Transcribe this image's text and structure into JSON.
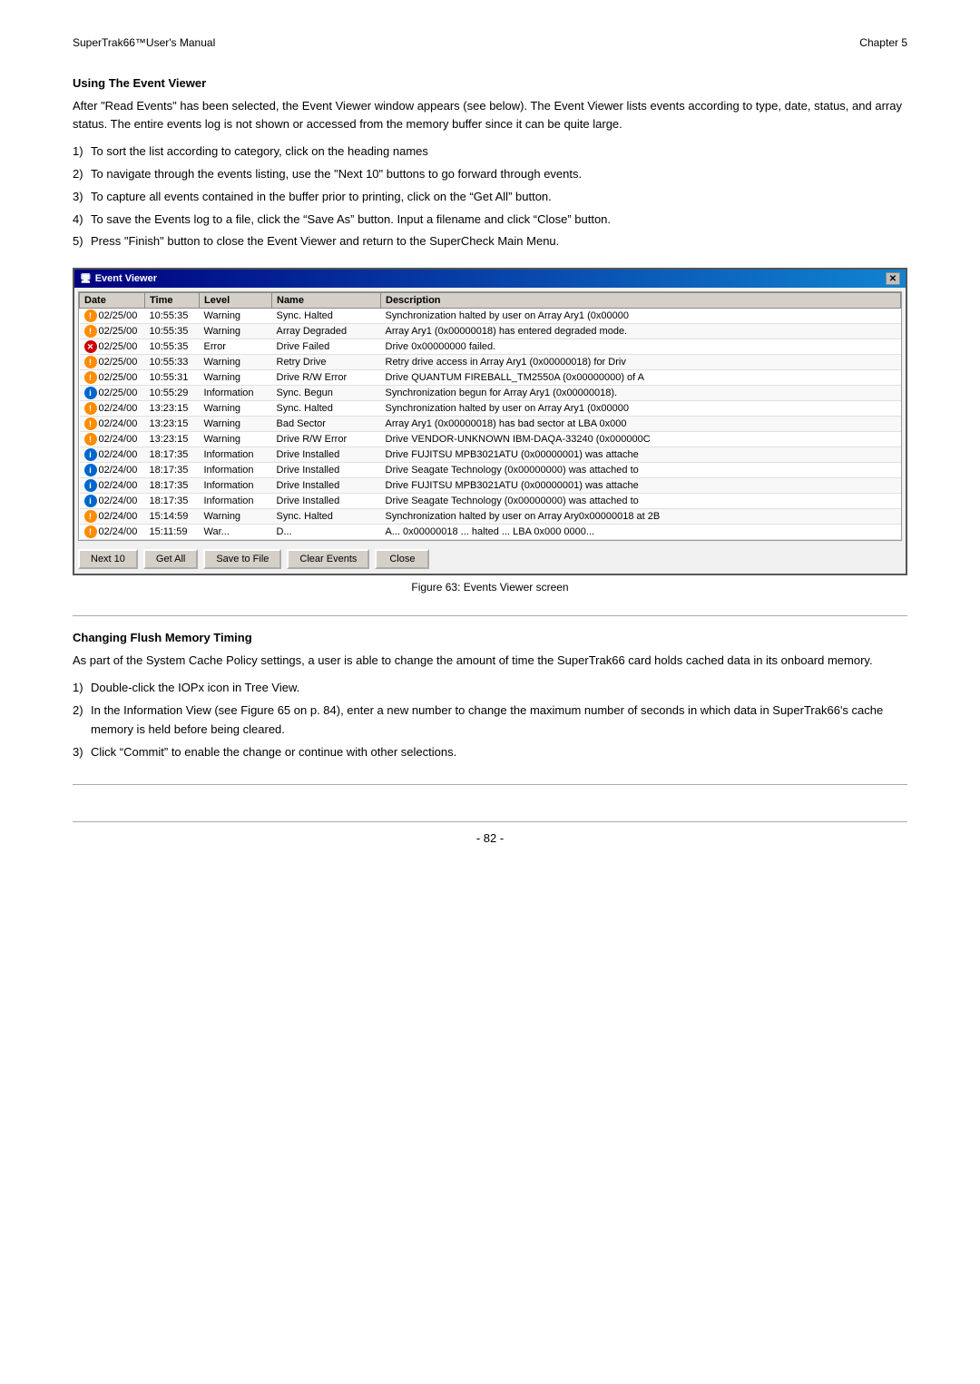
{
  "header": {
    "left": "SuperTrak66™User's Manual",
    "right": "Chapter 5"
  },
  "section1": {
    "title": "Using The Event Viewer",
    "body": "After \"Read Events\" has been selected, the Event Viewer window appears (see below). The Event Viewer lists events according to type, date, status, and array status. The entire events log is not shown or accessed from the memory buffer since it can be quite large.",
    "list": [
      {
        "num": "1)",
        "text": "To sort the list according to category, click on the heading names"
      },
      {
        "num": "2)",
        "text": "To navigate through the events listing, use the \"Next 10\" buttons to go forward through events."
      },
      {
        "num": "3)",
        "text": "To capture all events contained in the buffer prior to printing, click on the “Get All” button."
      },
      {
        "num": "4)",
        "text": "To save the Events log to a file, click the “Save As” button. Input a filename and click “Close” button."
      },
      {
        "num": "5)",
        "text": "Press \"Finish\" button to close the Event Viewer and return to the SuperCheck Main Menu."
      }
    ]
  },
  "event_viewer": {
    "title": "Event Viewer",
    "columns": [
      "Date",
      "Time",
      "Level",
      "Name",
      "Description"
    ],
    "rows": [
      {
        "icon": "warning",
        "date": "02/25/00",
        "time": "10:55:35",
        "level": "Warning",
        "name": "Sync. Halted",
        "desc": "Synchronization halted by user on Array Ary1     (0x00000"
      },
      {
        "icon": "warning",
        "date": "02/25/00",
        "time": "10:55:35",
        "level": "Warning",
        "name": "Array Degraded",
        "desc": "Array Ary1      (0x00000018) has entered degraded mode."
      },
      {
        "icon": "error",
        "date": "02/25/00",
        "time": "10:55:35",
        "level": "Error",
        "name": "Drive Failed",
        "desc": "Drive 0x00000000 failed."
      },
      {
        "icon": "warning",
        "date": "02/25/00",
        "time": "10:55:33",
        "level": "Warning",
        "name": "Retry Drive",
        "desc": "Retry drive access in Array Ary1      (0x00000018) for Driv"
      },
      {
        "icon": "warning",
        "date": "02/25/00",
        "time": "10:55:31",
        "level": "Warning",
        "name": "Drive R/W Error",
        "desc": "Drive QUANTUM FIREBALL_TM2550A (0x00000000) of A"
      },
      {
        "icon": "info",
        "date": "02/25/00",
        "time": "10:55:29",
        "level": "Information",
        "name": "Sync. Begun",
        "desc": "Synchronization begun for Array Ary1      (0x00000018)."
      },
      {
        "icon": "warning",
        "date": "02/24/00",
        "time": "13:23:15",
        "level": "Warning",
        "name": "Sync. Halted",
        "desc": "Synchronization halted by user on Array Ary1      (0x00000"
      },
      {
        "icon": "warning",
        "date": "02/24/00",
        "time": "13:23:15",
        "level": "Warning",
        "name": "Bad Sector",
        "desc": "Array Ary1      (0x00000018) has bad sector at LBA 0x000"
      },
      {
        "icon": "warning",
        "date": "02/24/00",
        "time": "13:23:15",
        "level": "Warning",
        "name": "Drive R/W Error",
        "desc": "Drive VENDOR-UNKNOWN IBM-DAQA-33240 (0x000000C"
      },
      {
        "icon": "info",
        "date": "02/24/00",
        "time": "18:17:35",
        "level": "Information",
        "name": "Drive Installed",
        "desc": "Drive FUJITSU MPB3021ATU (0x00000001) was attache"
      },
      {
        "icon": "info",
        "date": "02/24/00",
        "time": "18:17:35",
        "level": "Information",
        "name": "Drive Installed",
        "desc": "Drive Seagate Technology (0x00000000) was attached to"
      },
      {
        "icon": "info",
        "date": "02/24/00",
        "time": "18:17:35",
        "level": "Information",
        "name": "Drive Installed",
        "desc": "Drive FUJITSU MPB3021ATU (0x00000001) was attache"
      },
      {
        "icon": "info",
        "date": "02/24/00",
        "time": "18:17:35",
        "level": "Information",
        "name": "Drive Installed",
        "desc": "Drive Seagate Technology (0x00000000) was attached to"
      },
      {
        "icon": "warning",
        "date": "02/24/00",
        "time": "15:14:59",
        "level": "Warning",
        "name": "Sync. Halted",
        "desc": "Synchronization halted by user on Array Ary0x00000018 at 2B"
      },
      {
        "icon": "warning",
        "date": "02/24/00",
        "time": "15:11:59",
        "level": "War...",
        "name": "D...",
        "desc": "A... 0x00000018 ... halted ... LBA 0x000 0000..."
      }
    ],
    "buttons": [
      "Next 10",
      "Get All",
      "Save to File",
      "Clear Events",
      "Close"
    ]
  },
  "figure_caption": "Figure 63: Events Viewer screen",
  "section2": {
    "title": "Changing Flush Memory Timing",
    "body": "As part of the System Cache Policy settings, a user is able to change the amount of time the SuperTrak66 card holds cached data in its onboard memory.",
    "list": [
      {
        "num": "1)",
        "text": "Double-click the IOPx icon in Tree View."
      },
      {
        "num": "2)",
        "text": "In the Information View (see Figure 65 on p. 84), enter a new number to change the maximum number of seconds in which data in SuperTrak66's cache memory is held before being cleared."
      },
      {
        "num": "3)",
        "text": "Click “Commit” to enable the change or continue with other selections."
      }
    ]
  },
  "footer": {
    "page_number": "- 82 -"
  }
}
